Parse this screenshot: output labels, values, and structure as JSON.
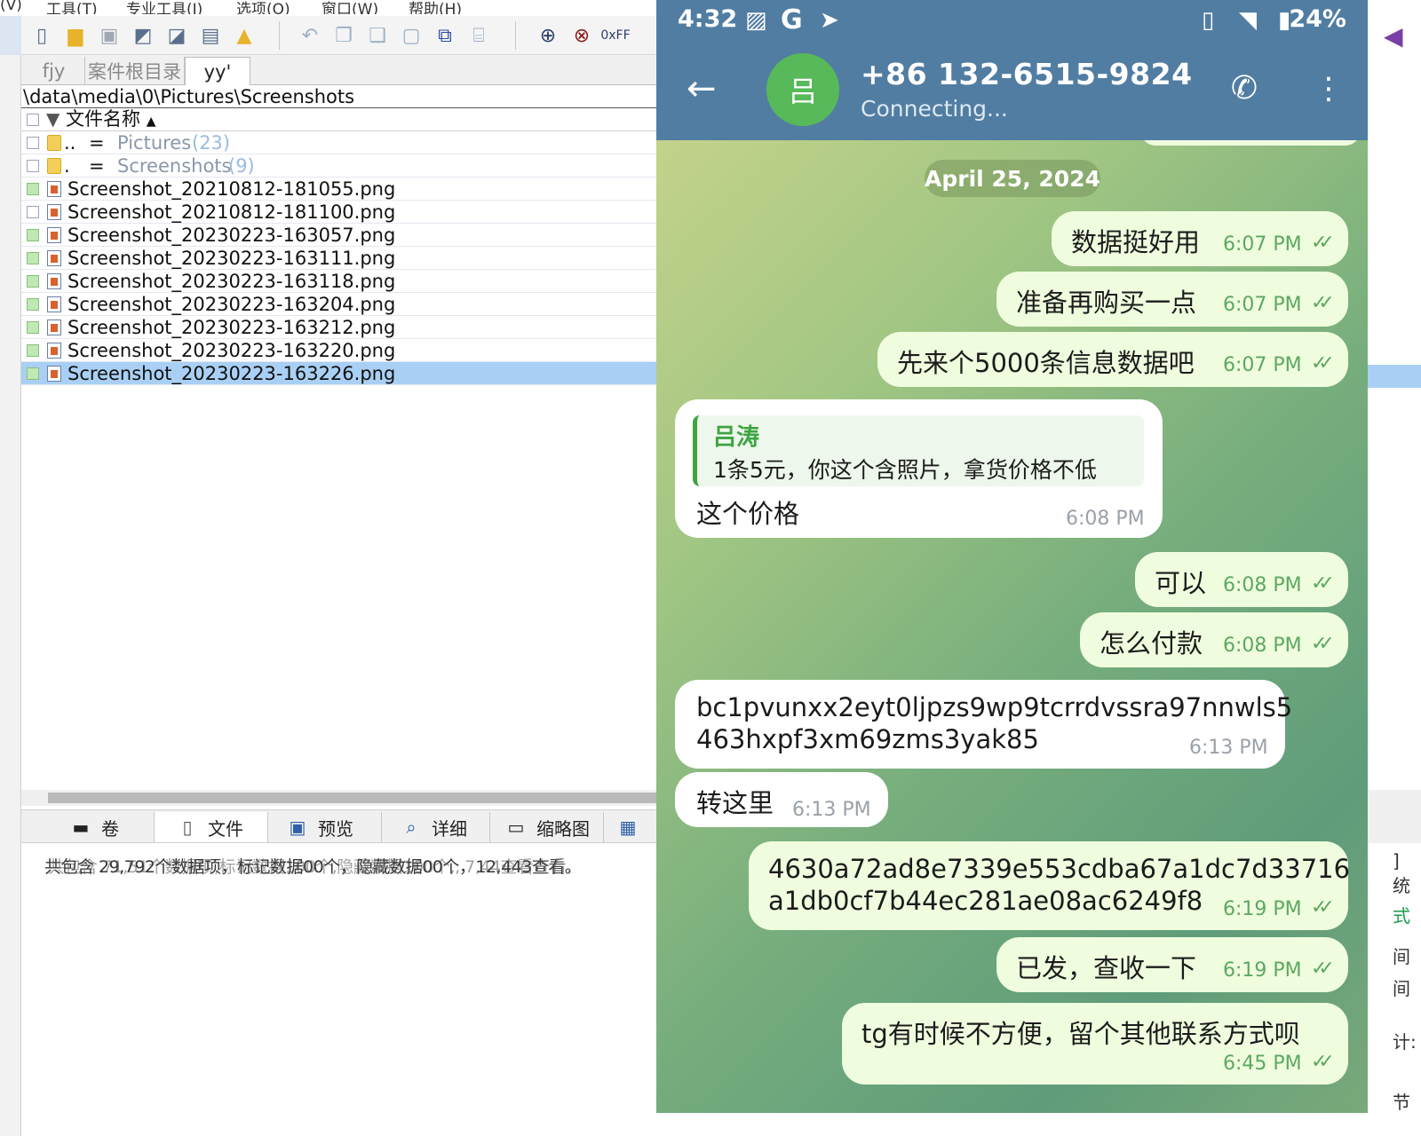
{
  "explorer": {
    "menu": [
      "(V)",
      "工具(T)",
      "专业工具(I)",
      "选项(O)",
      "窗口(W)",
      "帮助(H)"
    ],
    "tabs": [
      {
        "label": "fjy",
        "active": false
      },
      {
        "label": "案件根目录",
        "active": false
      },
      {
        "label": "yy'",
        "active": true
      }
    ],
    "path": "\\data\\media\\0\\Pictures\\Screenshots",
    "column_header": "文件名称",
    "rows": [
      {
        "prefix": "..",
        "eq": "=",
        "name": "Pictures",
        "count": "(23)",
        "type": "folder"
      },
      {
        "prefix": ".",
        "eq": "=",
        "name": "Screenshots",
        "count": "(9)",
        "type": "folder"
      },
      {
        "name": "Screenshot_20210812-181055.png",
        "type": "file",
        "checked": true
      },
      {
        "name": "Screenshot_20210812-181100.png",
        "type": "file",
        "checked": false
      },
      {
        "name": "Screenshot_20230223-163057.png",
        "type": "file",
        "checked": true
      },
      {
        "name": "Screenshot_20230223-163111.png",
        "type": "file",
        "checked": true
      },
      {
        "name": "Screenshot_20230223-163118.png",
        "type": "file",
        "checked": true
      },
      {
        "name": "Screenshot_20230223-163204.png",
        "type": "file",
        "checked": true
      },
      {
        "name": "Screenshot_20230223-163212.png",
        "type": "file",
        "checked": true
      },
      {
        "name": "Screenshot_20230223-163220.png",
        "type": "file",
        "checked": true
      },
      {
        "name": "Screenshot_20230223-163226.png",
        "type": "file",
        "checked": true,
        "selected": true
      }
    ],
    "bottom_tabs": [
      {
        "label": "卷",
        "icon": "drive-icon"
      },
      {
        "label": "文件",
        "icon": "file-icon"
      },
      {
        "label": "预览",
        "icon": "preview-icon"
      },
      {
        "label": "详细",
        "icon": "details-icon"
      },
      {
        "label": "缩略图",
        "icon": "thumbnail-icon"
      }
    ],
    "summary": "共包含 29,792个数据项，标记数据00个，隐藏数据00个，12,443查看。",
    "summary_overlay": "共包含 71,51个数据项,标记数据100个,隐藏数据100个,, 7,44查看查看."
  },
  "bgwin": {
    "texts": [
      "]",
      "统",
      "式",
      "间",
      "间",
      "计:",
      "节"
    ]
  },
  "phone": {
    "status": {
      "time": "4:32",
      "battery": "24%"
    },
    "contact": {
      "avatar": "吕",
      "name": "+86 132-6515-9824",
      "status": "Connecting..."
    },
    "date_chip": "April 25, 2024",
    "messages": [
      {
        "dir": "out",
        "text": "数据挺好用",
        "time": "6:07 PM"
      },
      {
        "dir": "out",
        "text": "准备再购买一点",
        "time": "6:07 PM"
      },
      {
        "dir": "out",
        "text": "先来个5000条信息数据吧",
        "time": "6:07 PM"
      },
      {
        "dir": "in",
        "reply_name": "吕涛",
        "reply_text": "1条5元，你这个含照片，拿货价格不低",
        "text": "这个价格",
        "time": "6:08 PM"
      },
      {
        "dir": "out",
        "text": "可以",
        "time": "6:08 PM"
      },
      {
        "dir": "out",
        "text": "怎么付款",
        "time": "6:08 PM"
      },
      {
        "dir": "in",
        "lines": [
          "bc1pvunxx2eyt0ljpzs9wp9tcrrdvssra97nnwls5",
          "463hxpf3xm69zms3yak85"
        ],
        "time": "6:13 PM"
      },
      {
        "dir": "in",
        "text": "转这里",
        "time": "6:13 PM"
      },
      {
        "dir": "out",
        "lines": [
          "4630a72ad8e7339e553cdba67a1dc7d33716",
          "a1db0cf7b44ec281ae08ac6249f8"
        ],
        "time": "6:19 PM"
      },
      {
        "dir": "out",
        "text": "已发，查收一下",
        "time": "6:19 PM"
      },
      {
        "dir": "out",
        "text": "tg有时候不方便，留个其他联系方式呗",
        "time": "6:45 PM"
      }
    ],
    "colors": {
      "header": "#517da2",
      "outgoing": "#effdde",
      "incoming": "#ffffff",
      "accent": "#5da861",
      "avatar": "#57b95a"
    }
  }
}
